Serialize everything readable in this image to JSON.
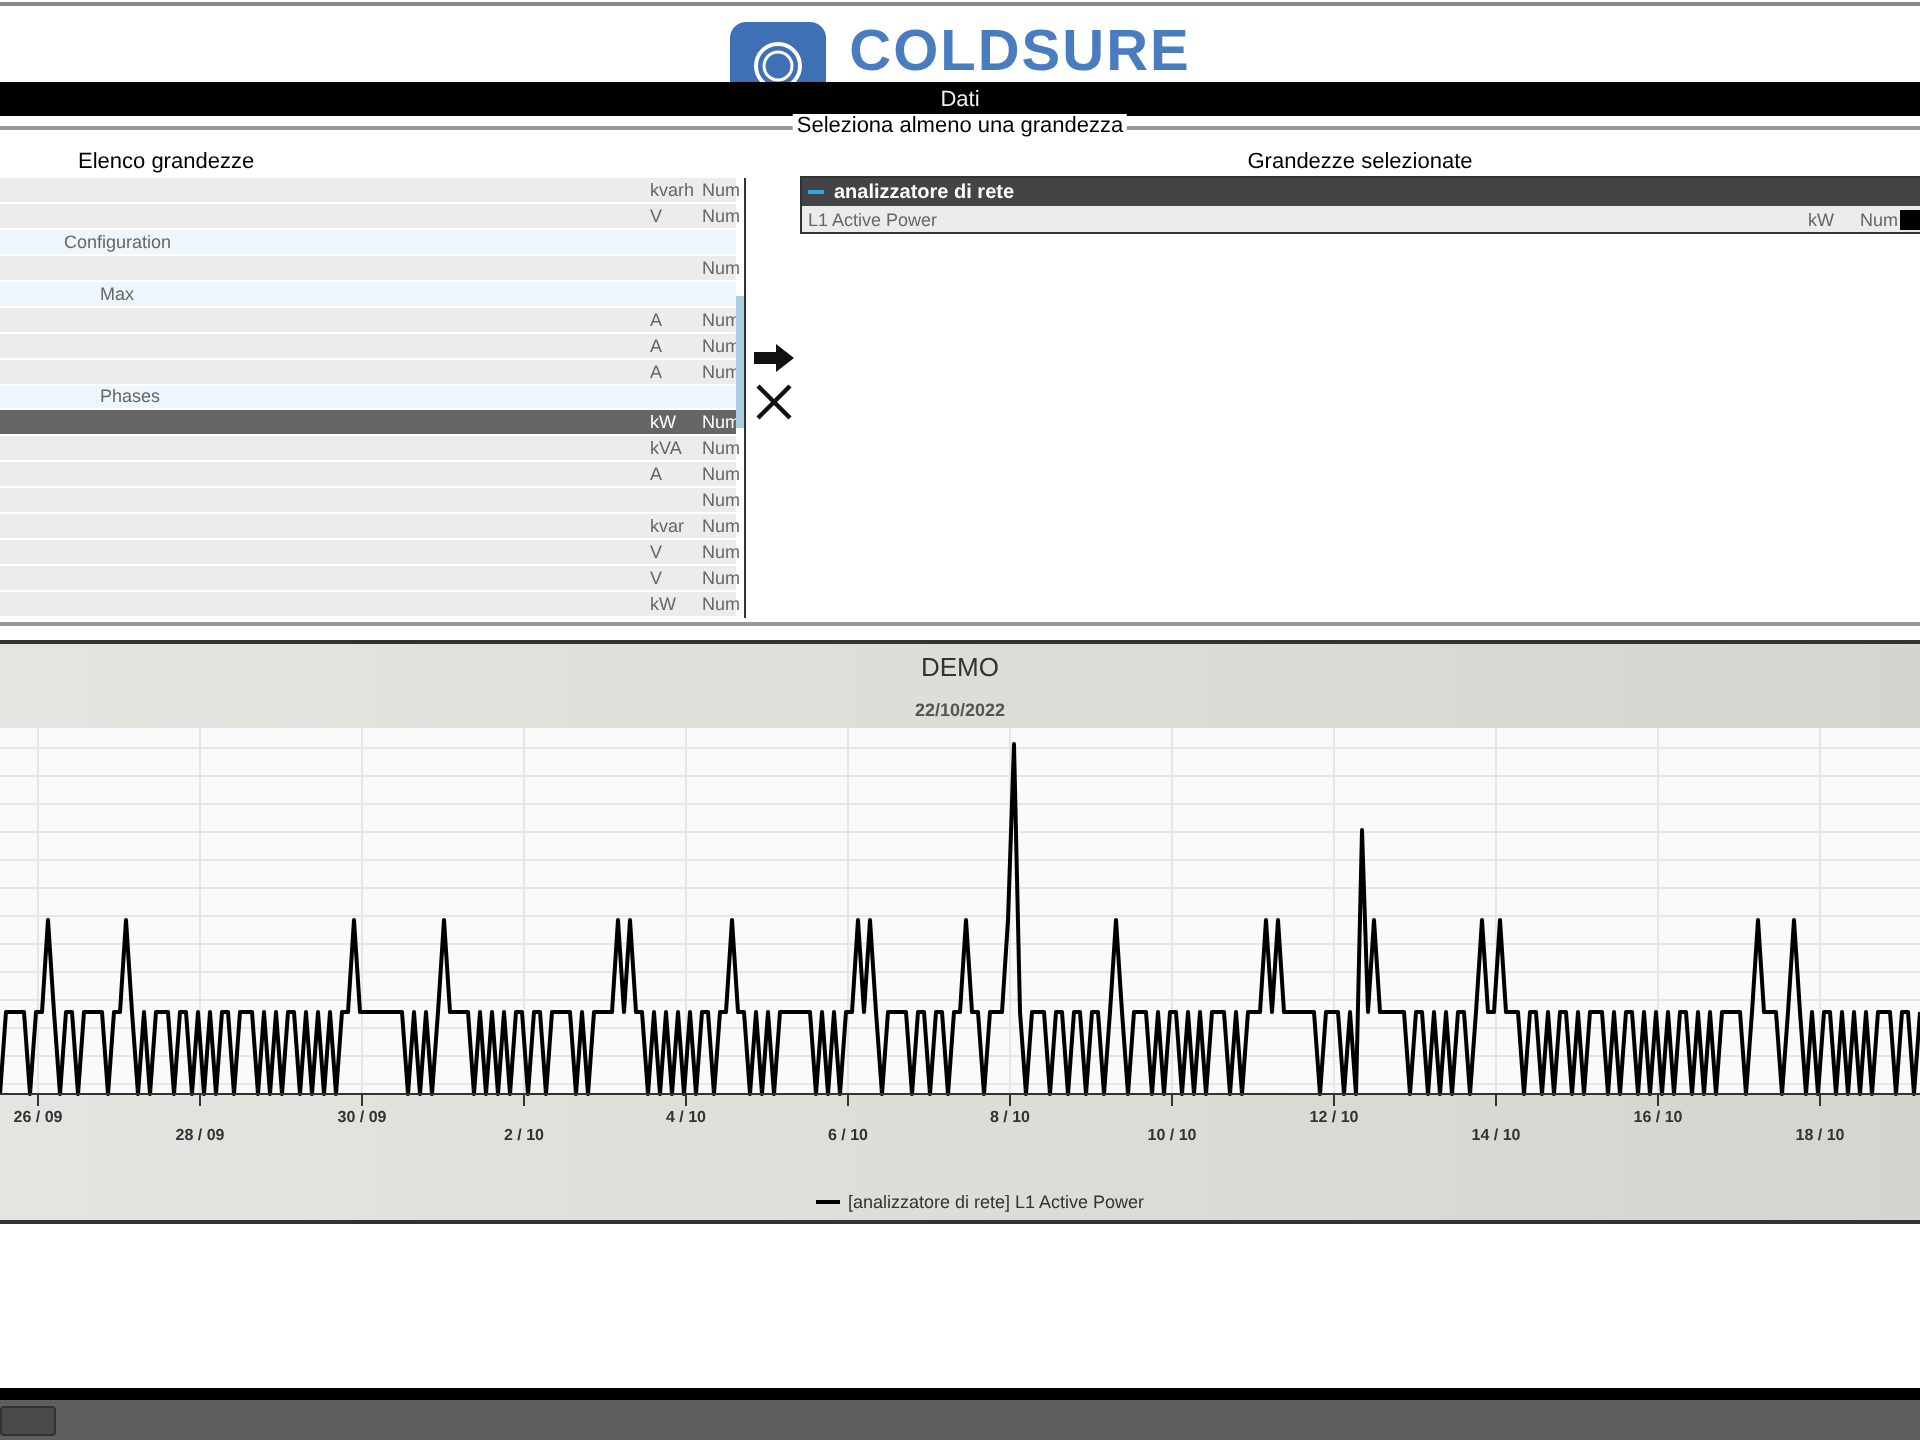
{
  "header": {
    "logo_text": "COLDSURE"
  },
  "title_bar": "Dati",
  "selection": {
    "legend": "Seleziona almeno una grandezza",
    "available": {
      "title": "Elenco grandezze",
      "rows": [
        {
          "kind": "item",
          "unit": "kvarh",
          "type": "Num",
          "selected": false
        },
        {
          "kind": "item",
          "unit": "V",
          "type": "Num",
          "selected": false
        },
        {
          "kind": "group",
          "label": "Configuration",
          "children": [
            {
              "kind": "item",
              "type": "Num",
              "selected": false
            },
            {
              "kind": "group",
              "label": "Max",
              "children": [
                {
                  "kind": "item",
                  "unit": "A",
                  "type": "Num",
                  "selected": false
                },
                {
                  "kind": "item",
                  "unit": "A",
                  "type": "Num",
                  "selected": false
                },
                {
                  "kind": "item",
                  "unit": "A",
                  "type": "Num",
                  "selected": false
                }
              ]
            },
            {
              "kind": "group",
              "label": "Phases",
              "children": [
                {
                  "kind": "item",
                  "unit": "kW",
                  "type": "Num",
                  "selected": true
                },
                {
                  "kind": "item",
                  "unit": "kVA",
                  "type": "Num",
                  "selected": false
                },
                {
                  "kind": "item",
                  "unit": "A",
                  "type": "Num",
                  "selected": false
                },
                {
                  "kind": "item",
                  "type": "Num",
                  "selected": false
                },
                {
                  "kind": "item",
                  "unit": "kvar",
                  "type": "Num",
                  "selected": false
                },
                {
                  "kind": "item",
                  "unit": "V",
                  "type": "Num",
                  "selected": false
                },
                {
                  "kind": "item",
                  "unit": "V",
                  "type": "Num",
                  "selected": false
                },
                {
                  "kind": "item",
                  "unit": "kW",
                  "type": "Num",
                  "selected": false
                }
              ]
            }
          ]
        }
      ]
    },
    "selected": {
      "title": "Grandezze selezionate",
      "groups": [
        {
          "name": "analizzatore di rete",
          "expanded": true,
          "rows": [
            {
              "name": "L1 Active Power",
              "unit": "kW",
              "type": "Num",
              "color": "#000000"
            }
          ]
        }
      ]
    }
  },
  "chart": {
    "title": "DEMO",
    "date": "22/10/2022",
    "x_labels": [
      "26 / 09",
      "28 / 09",
      "30 / 09",
      "2 / 10",
      "4 / 10",
      "6 / 10",
      "8 / 10",
      "10 / 10",
      "12 / 10",
      "14 / 10",
      "16 / 10",
      "18 / 10"
    ],
    "legend": [
      {
        "label": "[analizzatore di rete] L1 Active Power",
        "color": "#000000"
      }
    ]
  }
}
